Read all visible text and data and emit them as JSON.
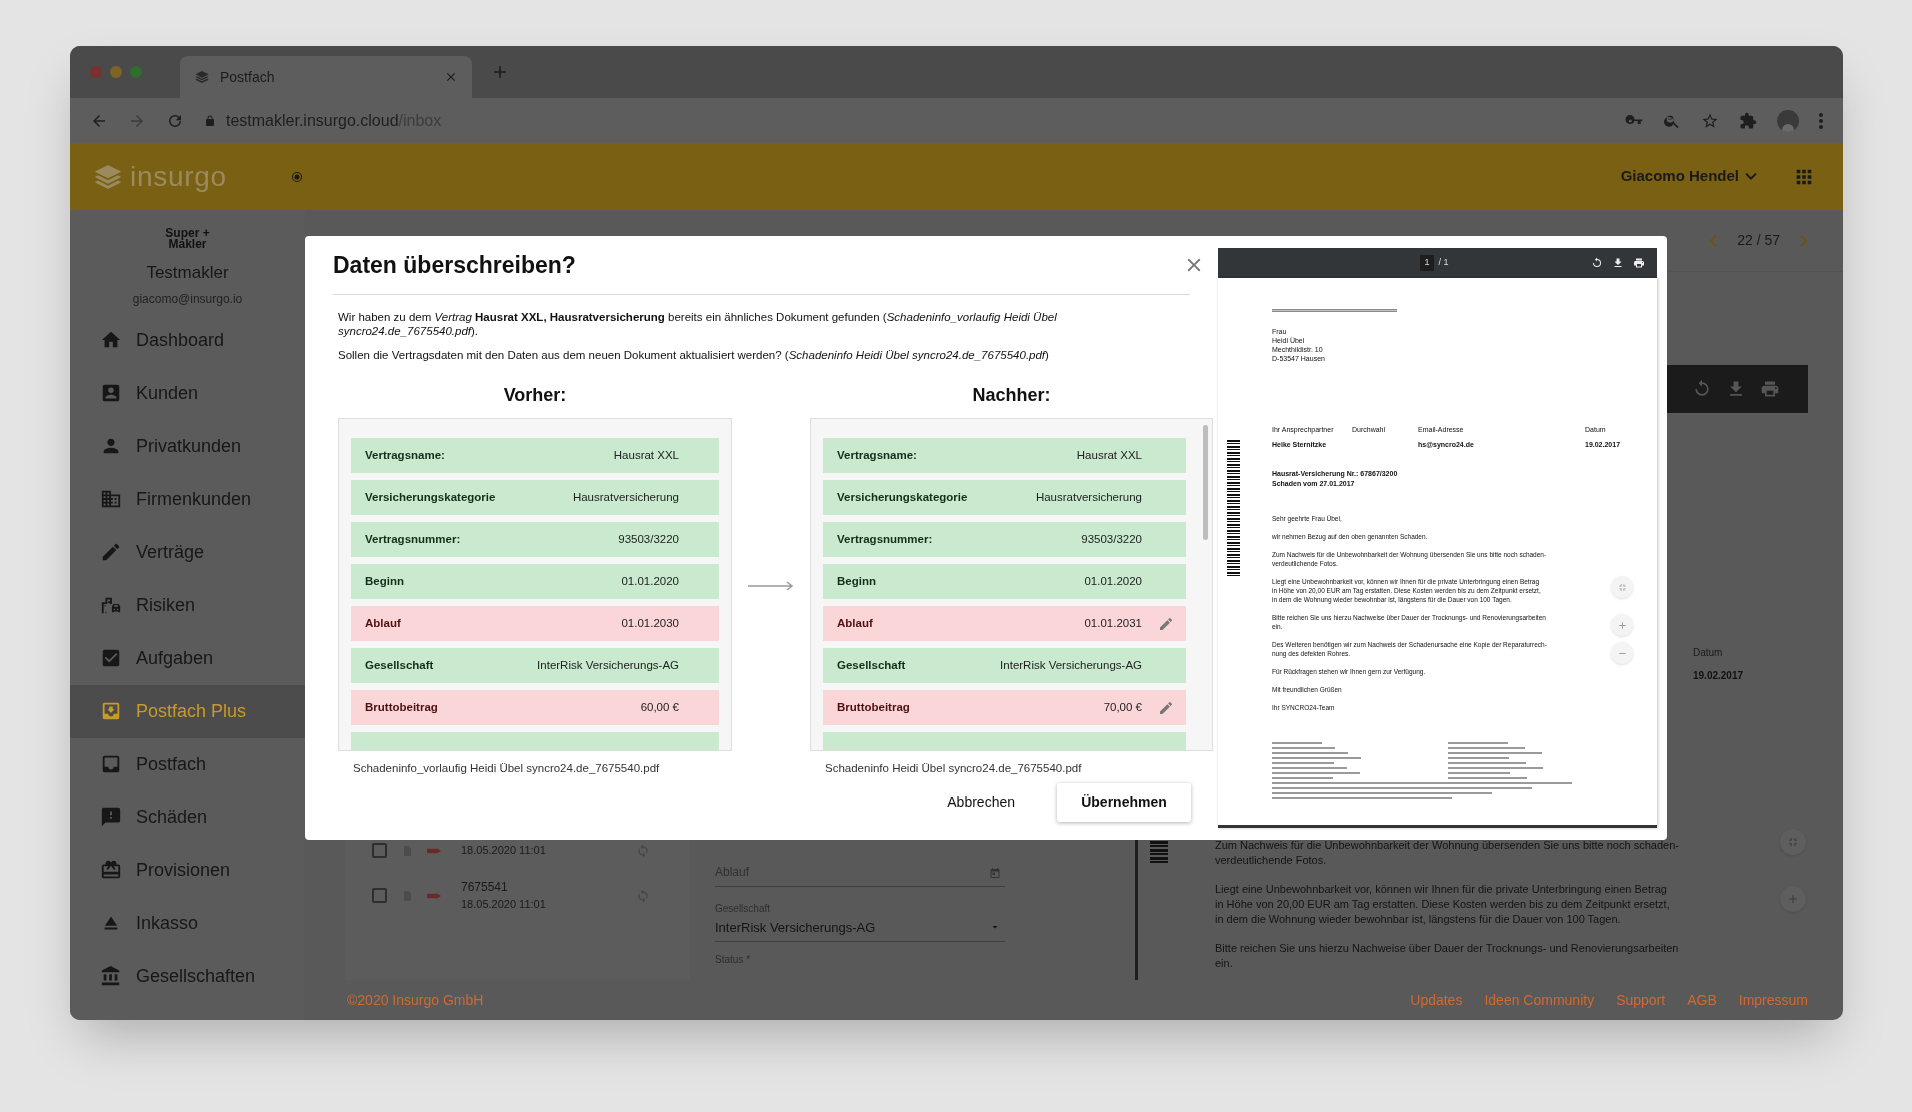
{
  "browser": {
    "tab_title": "Postfach",
    "url_host": "testmakler.insurgo.cloud",
    "url_path": "/inbox"
  },
  "header": {
    "logo": "insurgo",
    "user": "Giacomo Hendel"
  },
  "sidebar": {
    "brand": [
      "Super +",
      "Makler"
    ],
    "account": "Testmakler",
    "email": "giacomo@insurgo.io",
    "items": [
      {
        "label": "Dashboard",
        "selected": false
      },
      {
        "label": "Kunden",
        "selected": false
      },
      {
        "label": "Privatkunden",
        "selected": false
      },
      {
        "label": "Firmenkunden",
        "selected": false
      },
      {
        "label": "Verträge",
        "selected": false
      },
      {
        "label": "Risiken",
        "selected": false
      },
      {
        "label": "Aufgaben",
        "selected": false
      },
      {
        "label": "Postfach Plus",
        "selected": true
      },
      {
        "label": "Postfach",
        "selected": false
      },
      {
        "label": "Schäden",
        "selected": false
      },
      {
        "label": "Provisionen",
        "selected": false
      },
      {
        "label": "Inkasso",
        "selected": false
      },
      {
        "label": "Gesellschaften",
        "selected": false
      }
    ]
  },
  "pager": "22 / 57",
  "inbox_rows": [
    {
      "time": "18.05.2020 11:01",
      "checked": false
    },
    {
      "number": "7675541",
      "time": "18.05.2020 11:01",
      "checked": false
    }
  ],
  "form": {
    "expiry_placeholder": "Ablauf",
    "company_label": "Gesellschaft",
    "company_value": "InterRisk Versicherungs-AG",
    "status_label": "Status *"
  },
  "background_document": {
    "date_label": "Datum",
    "date_value": "19.02.2017",
    "paragraphs": [
      "Zum Nachweis für die Unbewohnbarkeit der Wohnung übersenden Sie uns bitte noch schaden-\nverdeutlichende Fotos.",
      "Liegt eine Unbewohnbarkeit vor, können wir Ihnen für die private Unterbringung einen Betrag\nin Höhe von 20,00 EUR am Tag erstatten. Diese Kosten werden bis zu dem Zeitpunkt ersetzt,\nin dem die Wohnung wieder bewohnbar ist, längstens für die Dauer von 100 Tagen.",
      "Bitte reichen Sie uns hierzu Nachweise über Dauer der Trocknungs- und Renovierungsarbeiten\nein."
    ]
  },
  "footer": {
    "copyright": "©2020 Insurgo GmbH",
    "links": [
      "Updates",
      "Ideen Community",
      "Support",
      "AGB",
      "Impressum"
    ]
  },
  "dialog": {
    "title": "Daten überschreiben?",
    "intro": "Wir haben zu dem *Vertrag* **Hausrat XXL, Hausratversicherung** bereits ein ähnliches Dokument gefunden (*Schadeninfo_vorlaufig Heidi Übel syncro24.de_7675540.pdf*).",
    "question": "Sollen die Vertragsdaten mit den Daten aus dem neuen Dokument aktualisiert werden? (*Schadeninfo Heidi Übel syncro24.de_7675540.pdf*)",
    "before": {
      "heading": "Vorher:",
      "file": "Schadeninfo_vorlaufig Heidi Übel syncro24.de_7675540.pdf",
      "rows": [
        {
          "label": "Vertragsname:",
          "value": "Hausrat XXL",
          "changed": false
        },
        {
          "label": "Versicherungskategorie",
          "value": "Hausratversicherung",
          "changed": false
        },
        {
          "label": "Vertragsnummer:",
          "value": "93503/3220",
          "changed": false
        },
        {
          "label": "Beginn",
          "value": "01.01.2020",
          "changed": false
        },
        {
          "label": "Ablauf",
          "value": "01.01.2030",
          "changed": true
        },
        {
          "label": "Gesellschaft",
          "value": "InterRisk Versicherungs-AG",
          "changed": false
        },
        {
          "label": "Bruttobeitrag",
          "value": "60,00 €",
          "changed": true
        }
      ]
    },
    "after": {
      "heading": "Nachher:",
      "file": "Schadeninfo Heidi Übel syncro24.de_7675540.pdf",
      "rows": [
        {
          "label": "Vertragsname:",
          "value": "Hausrat XXL",
          "changed": false
        },
        {
          "label": "Versicherungskategorie",
          "value": "Hausratversicherung",
          "changed": false
        },
        {
          "label": "Vertragsnummer:",
          "value": "93503/3220",
          "changed": false
        },
        {
          "label": "Beginn",
          "value": "01.01.2020",
          "changed": false
        },
        {
          "label": "Ablauf",
          "value": "01.01.2031",
          "changed": true
        },
        {
          "label": "Gesellschaft",
          "value": "InterRisk Versicherungs-AG",
          "changed": false
        },
        {
          "label": "Bruttobeitrag",
          "value": "70,00 €",
          "changed": true
        }
      ]
    },
    "cancel": "Abbrechen",
    "confirm": "Übernehmen"
  },
  "preview": {
    "page": "1",
    "page_total": "/ 1",
    "document": {
      "address": "Frau\nHeidi Übel\nMechthildistr. 10\nD-53547 Hausen",
      "info": [
        {
          "label": "Ihr Ansprechpartner",
          "value": "Heike Sternitzke"
        },
        {
          "label": "Durchwahl"
        },
        {
          "label": "Email-Adresse",
          "value": "hs@syncro24.de"
        },
        {
          "label": "Datum",
          "value": "19.02.2017"
        }
      ],
      "subject": "Hausrat-Versicherung Nr.: 67867/3200\nSchaden vom 27.01.2017",
      "paragraphs": [
        "Sehr geehrte Frau Übel,",
        "wir nehmen Bezug auf den oben genannten Schaden.",
        "Zum Nachweis für die Unbewohnbarkeit der Wohnung übersenden Sie uns bitte noch schaden-\nverdeutlichende Fotos.",
        "Liegt eine Unbewohnbarkeit vor, können wir Ihnen für die private Unterbringung einen Betrag\nin Höhe von 20,00 EUR am Tag erstatten. Diese Kosten werden bis zu dem Zeitpunkt ersetzt,\nin dem die Wohnung wieder bewohnbar ist, längstens für die Dauer von 100 Tagen.",
        "Bitte reichen Sie uns hierzu Nachweise über Dauer der Trocknungs- und Renovierungsarbeiten\nein.",
        "Des Weiteren benötigen wir zum Nachweis der Schadenursache eine Kopie der Reparaturrech-\nnung des defekten Rohres.",
        "Für Rückfragen stehen wir Ihnen gern zur Verfügung.",
        "Mit freundlichen Grüßen",
        "Ihr SYNCRO24-Team"
      ]
    }
  }
}
